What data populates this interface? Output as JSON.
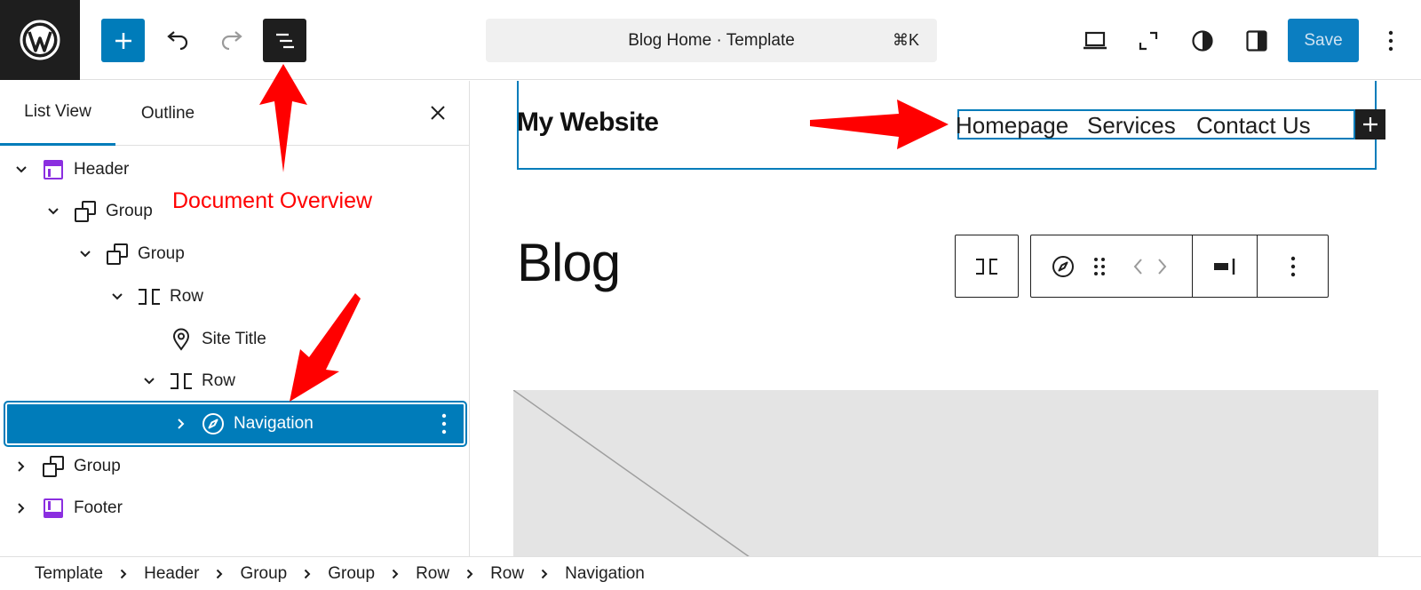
{
  "topbar": {
    "command_title": "Blog Home · Template",
    "command_shortcut": "⌘K",
    "save_label": "Save",
    "icons": [
      "wordpress-logo",
      "plus-icon",
      "undo-icon",
      "redo-icon",
      "document-overview-icon",
      "laptop-icon",
      "fullscreen-icon",
      "styles-icon",
      "sidebar-icon",
      "more-vertical-icon"
    ]
  },
  "panel": {
    "tabs": [
      {
        "label": "List View",
        "active": true
      },
      {
        "label": "Outline",
        "active": false
      }
    ],
    "tree": [
      {
        "label": "Header",
        "icon": "header-icon",
        "expanded": true
      },
      {
        "label": "Group",
        "icon": "group-icon",
        "expanded": true
      },
      {
        "label": "Group",
        "icon": "group-icon",
        "expanded": true
      },
      {
        "label": "Row",
        "icon": "row-icon",
        "expanded": true
      },
      {
        "label": "Site Title",
        "icon": "map-pin-icon",
        "expanded": null
      },
      {
        "label": "Row",
        "icon": "row-icon",
        "expanded": true
      },
      {
        "label": "Navigation",
        "icon": "compass-icon",
        "expanded": false,
        "selected": true
      },
      {
        "label": "Group",
        "icon": "group-icon",
        "expanded": false
      },
      {
        "label": "Footer",
        "icon": "footer-icon",
        "expanded": false
      }
    ]
  },
  "canvas": {
    "site_title": "My Website",
    "nav_items": [
      "Homepage",
      "Services",
      "Contact Us"
    ],
    "heading": "Blog"
  },
  "breadcrumb": [
    "Template",
    "Header",
    "Group",
    "Group",
    "Row",
    "Row",
    "Navigation"
  ],
  "annotations": {
    "document_overview_label": "Document Overview"
  },
  "colors": {
    "accent": "#007cba",
    "dark": "#1e1e1e",
    "annotation": "#ff0000",
    "template_part_icon": "#8b2fe0"
  }
}
